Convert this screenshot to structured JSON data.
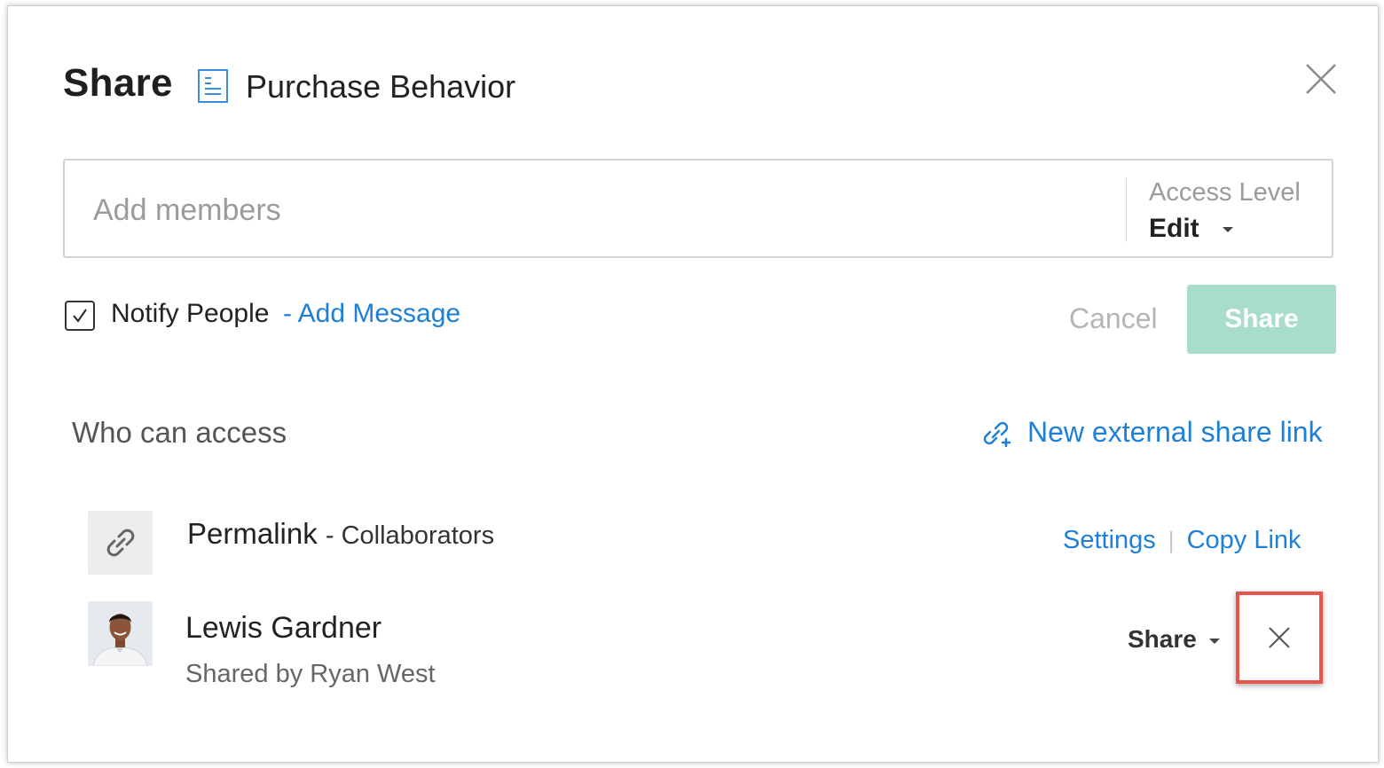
{
  "dialog": {
    "title": "Share",
    "document_icon": "document-icon",
    "document_name": "Purchase Behavior",
    "close_icon": "close-icon"
  },
  "add_members": {
    "placeholder": "Add members",
    "value": "",
    "access_level_label": "Access Level",
    "access_level_value": "Edit"
  },
  "notify": {
    "checked": true,
    "label": "Notify People",
    "add_message": "- Add Message"
  },
  "actions": {
    "cancel_label": "Cancel",
    "share_label": "Share"
  },
  "access": {
    "heading": "Who can access",
    "new_link_label": "New external share link",
    "new_link_icon": "link-plus-icon",
    "permalink": {
      "icon": "link-icon",
      "title": "Permalink",
      "subtitle": "- Collaborators",
      "settings_label": "Settings",
      "separator": "|",
      "copy_label": "Copy Link"
    },
    "users": [
      {
        "name": "Lewis Gardner",
        "shared_by": "Shared by Ryan West",
        "role": "Share",
        "remove_icon": "close-icon"
      }
    ]
  },
  "colors": {
    "link": "#1e7fd6",
    "share_button_bg": "#a8dccd",
    "highlight": "#e8544b"
  }
}
